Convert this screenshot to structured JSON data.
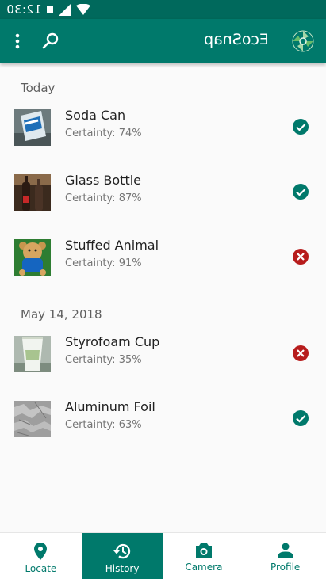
{
  "status_bar": {
    "time": "12:30",
    "icons": [
      "notification-icon",
      "signal-icon",
      "wifi-icon"
    ]
  },
  "app_bar": {
    "title": "EcoSnap",
    "menu_icon": "more-vert-icon",
    "search_icon": "search-icon",
    "logo_icon": "ecosnap-logo-icon"
  },
  "sections": [
    {
      "header": "Today",
      "items": [
        {
          "name": "Soda Can",
          "certainty": "Certainty: 74%",
          "status": "check-icon"
        },
        {
          "name": "Glass Bottle",
          "certainty": "Certainty: 87%",
          "status": "check-icon"
        },
        {
          "name": "Stuffed Animal",
          "certainty": "Certainty: 91%",
          "status": "cancel-icon"
        }
      ]
    },
    {
      "header": "May 14, 2018",
      "items": [
        {
          "name": "Styrofoam Cup",
          "certainty": "Certainty: 35%",
          "status": "cancel-icon"
        },
        {
          "name": "Aluminum Foil",
          "certainty": "Certainty: 63%",
          "status": "check-icon"
        }
      ]
    }
  ],
  "bottom_nav": [
    {
      "label": "Locate",
      "icon": "location-pin-icon",
      "active": false
    },
    {
      "label": "History",
      "icon": "history-icon",
      "active": true
    },
    {
      "label": "Camera",
      "icon": "camera-icon",
      "active": false
    },
    {
      "label": "Profile",
      "icon": "person-icon",
      "active": false
    }
  ],
  "colors": {
    "status_bar": "#00695c",
    "primary": "#00796b",
    "success": "#00796b",
    "error": "#b71c1c"
  }
}
